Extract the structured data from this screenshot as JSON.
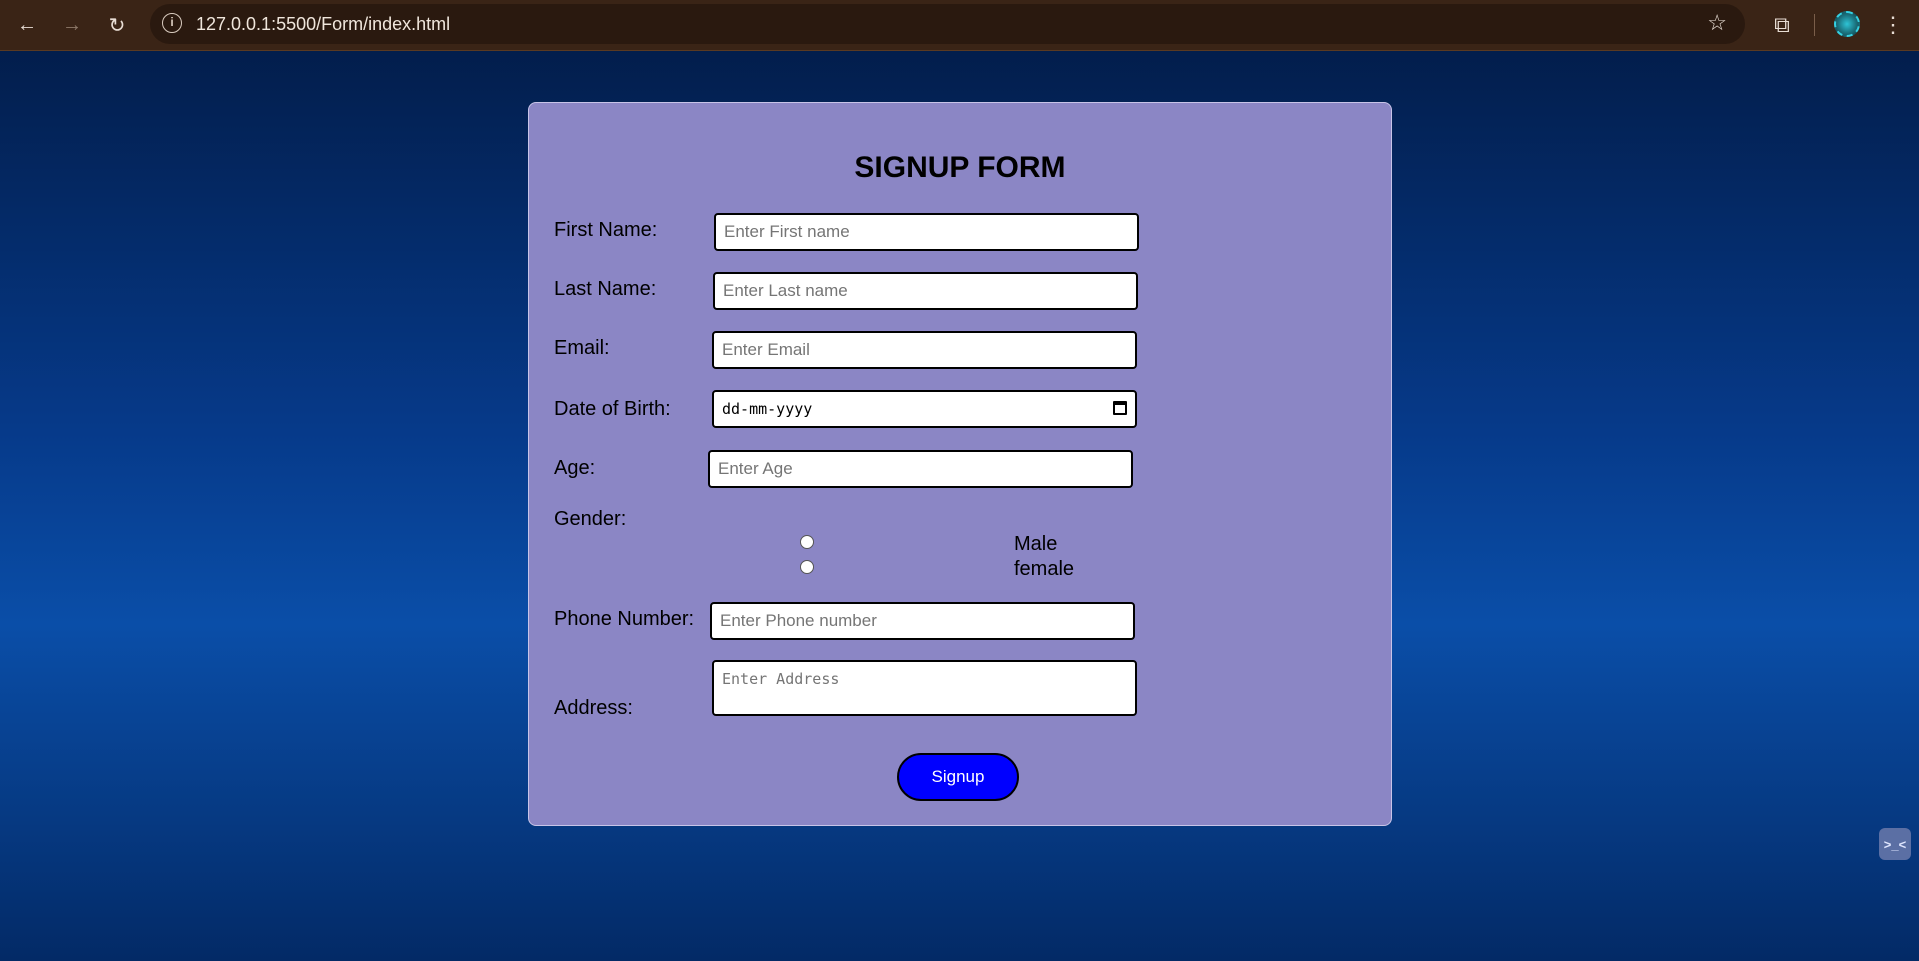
{
  "browser": {
    "url": "127.0.0.1:5500/Form/index.html",
    "back_icon": "←",
    "forward_icon": "→",
    "reload_icon": "↻",
    "info_icon": "i",
    "star_icon": "☆",
    "extensions_icon": "⧉",
    "menu_icon": "⋮"
  },
  "form": {
    "title": "SIGNUP FORM",
    "fields": {
      "first_name": {
        "label": "First Name:",
        "placeholder": "Enter First name"
      },
      "last_name": {
        "label": "Last Name:",
        "placeholder": "Enter Last name"
      },
      "email": {
        "label": "Email:",
        "placeholder": "Enter Email"
      },
      "dob": {
        "label": "Date of Birth:",
        "value": "dd-mm-yyyy"
      },
      "age": {
        "label": "Age:",
        "placeholder": "Enter Age"
      },
      "gender": {
        "label": "Gender:",
        "options": [
          "Male",
          "female"
        ]
      },
      "phone": {
        "label": "Phone Number:",
        "placeholder": "Enter Phone number"
      },
      "address": {
        "label": "Address:",
        "placeholder": "Enter Address"
      }
    },
    "submit_label": "Signup"
  },
  "widget": {
    "icon_text": ">_<"
  }
}
